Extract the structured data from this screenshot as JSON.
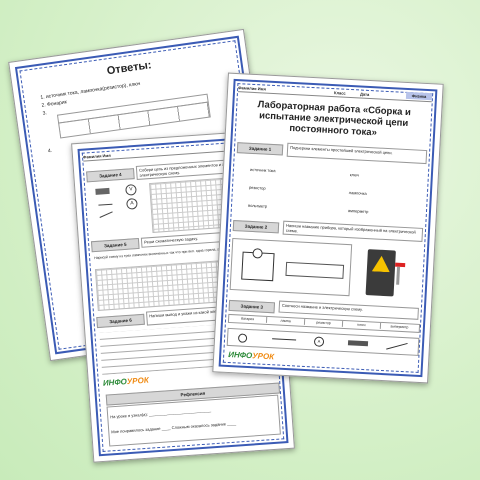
{
  "answers_sheet": {
    "title": "Ответы:",
    "items": [
      "1.",
      "2.",
      "3.",
      "4."
    ],
    "item1": "источник тока, лампочка(резистор), ключ",
    "item2": "Фонарик"
  },
  "worksheet": {
    "header_name": "Фамилия Имя",
    "header_class": "Кла",
    "task4_label": "Задание 4",
    "task4_text": "Собери цепь из предложенных элементов и зарисуй электрическую схему.",
    "task5_label": "Задание 5",
    "task5_text": "Реши схематическую задачу.",
    "task5_sub": "Нарисуй схему из трех лампочек включенных так что при вкл. одна горела, а другого горят одна",
    "task6_label": "Задание 6",
    "task6_text": "Напиши вывод и укажи из какой электрическая цепь.",
    "reflection_label": "Рефлексия",
    "ref_line1": "На уроке я узнал(а): ____________________________",
    "ref_line2": "Мне понравилось задание ____ Сложным оказалось задание ____",
    "logo_a": "ИНФО",
    "logo_b": "УРОК"
  },
  "lab_sheet": {
    "header_name": "Фамилия Имя",
    "header_class": "Класс",
    "header_date": "Дата",
    "subject": "Физика",
    "title": "Лабораторная работа «Сборка и испытание электрической цепи постоянного тока»",
    "task1_label": "Задание 1",
    "task1_text": "Подчеркни элементы простейшей электрической цепи.",
    "words": [
      "источник тока",
      "ключ",
      "резистор",
      "лампочка",
      "вольтметр",
      "амперметр"
    ],
    "task2_label": "Задание 2",
    "task2_text": "Напиши название прибора, который изображенный на электрической схеме.",
    "task3_label": "Задание 3",
    "task3_text": "Соотнеси название и электрическую схему.",
    "table_cells": [
      "батарея",
      "лампа",
      "резистор",
      "ключ",
      "амперметр"
    ],
    "logo_a": "ИНФО",
    "logo_b": "УРОК"
  }
}
